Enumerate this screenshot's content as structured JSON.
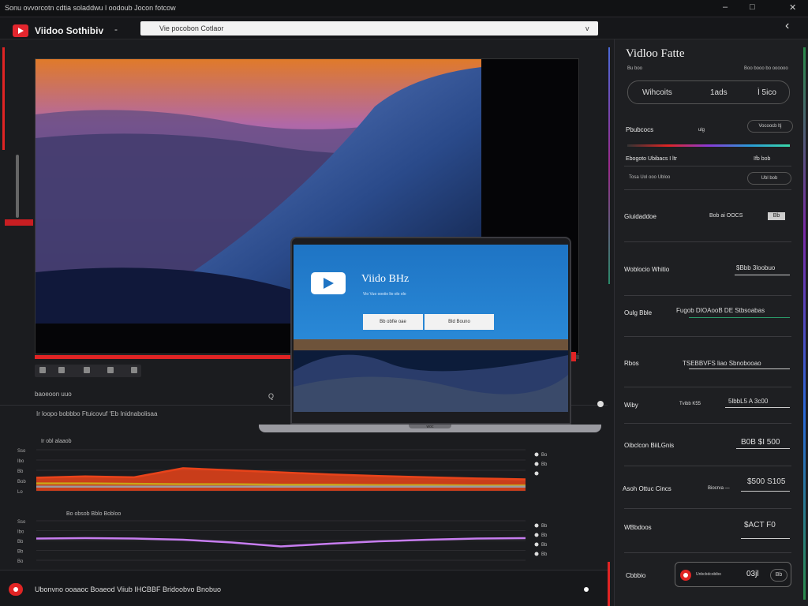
{
  "window": {
    "title": "Sonu  ovvorcotn cdtia  soladdwu l oodoub  Jocon fotcow"
  },
  "toolbar": {
    "app_title": "Viidoo Sothibiv",
    "dash": "-",
    "search_value": "Vie pocobon Cotlaor",
    "search_caret": "v"
  },
  "player": {
    "progress": 0.47
  },
  "meta": {
    "line1": "baoeoon uuo",
    "line2": "Ir loopo bobbbo   Ftuicovuf   ‘Eb   Inidnabolisaa",
    "search_btn": "Q"
  },
  "laptop": {
    "screen_title": "Viido BHz",
    "screen_sub": "Vio Vuo oooiio lio olo olo",
    "btn1": "Bb obfie oae",
    "btn2": "Bld Bouno",
    "notch_label": "woc"
  },
  "chart_data": [
    {
      "type": "area",
      "title": "Ir obl alaaob",
      "ylabel_ticks": [
        "Sso",
        "Ibo",
        "Bb",
        "Bob",
        "Lo"
      ],
      "x": [
        0,
        10,
        20,
        30,
        40,
        50,
        60,
        70,
        80,
        90,
        100
      ],
      "series": [
        {
          "values": [
            0.32,
            0.35,
            0.33,
            0.55,
            0.5,
            0.45,
            0.4,
            0.36,
            0.33,
            0.3,
            0.28
          ],
          "color": "#e8431a"
        },
        {
          "values": [
            0.18,
            0.18,
            0.17,
            0.16,
            0.16,
            0.15,
            0.15,
            0.14,
            0.14,
            0.13,
            0.13
          ],
          "color": "#c9a41a"
        },
        {
          "values": [
            0.1,
            0.1,
            0.1,
            0.1,
            0.1,
            0.1,
            0.1,
            0.1,
            0.1,
            0.1,
            0.1
          ],
          "color": "#9a9aa0"
        }
      ],
      "legend": [
        "Bo",
        "Bb",
        ""
      ]
    },
    {
      "type": "line",
      "title": "Bo obsob  Bblo  Bobloo",
      "ylabel_ticks": [
        "Sso",
        "Ibo",
        "Bb",
        "Bb",
        "Bo"
      ],
      "x": [
        0,
        10,
        20,
        30,
        40,
        50,
        60,
        70,
        80,
        90,
        100
      ],
      "series": [
        {
          "values": [
            0.55,
            0.56,
            0.55,
            0.52,
            0.45,
            0.35,
            0.42,
            0.48,
            0.52,
            0.55,
            0.56
          ],
          "color": "#c77df0"
        }
      ],
      "legend": [
        "Bb",
        "Bb",
        "Bb",
        "Bb"
      ]
    }
  ],
  "footer": {
    "text": "Ubonvno ooaaoc  Boaeod Viiub  IHCBBF  Bridoobvo Bnobuo"
  },
  "panel": {
    "title": "Vidloo Fatte",
    "sub_left": "Bu boo",
    "sub_right": "Boo booo bo oooooo",
    "box": {
      "left": "Wihcoits",
      "mid": "1ads",
      "right": "Ì 5ico"
    },
    "rows": [
      {
        "label": "Pbubcocs",
        "mid": "ulg",
        "pill": "Vocoocb  ltj"
      },
      {
        "label": "Ebogoto Ubibacs I    ltr",
        "val": "Ifb bob"
      },
      {
        "label": "Tosa Uol ooo Ubloo",
        "pill": "Ubl bob"
      },
      {
        "label": "Giuidaddoe",
        "mid": "Bob  ai OOCS",
        "chip": "Bb"
      },
      {
        "label": "Woblocio Whitio",
        "val": "$Bbb 3loobuo"
      },
      {
        "label": "Oulg Bble",
        "val": "Fugob DIOAooB DE Stbsoabas"
      },
      {
        "label": "Rbos",
        "val": "TSEBBVFS liao Sbnobooao"
      },
      {
        "label": "Wiby",
        "mid": "Tvibb K55",
        "val": "5lbbL5 A 3c00"
      },
      {
        "label": "Oibclcon BiiLGnis",
        "val": "B0B  $I 500"
      },
      {
        "label": "Asoh  Ottuc Cincs",
        "mid": "Biocrva  —",
        "val": "$500  S105"
      },
      {
        "label": "WBbdoos",
        "val": "$ACT F0"
      }
    ],
    "foot": {
      "label": "Cbbbio",
      "inner_label": "Unbcbdcobibo",
      "value": "03jl",
      "pill": "Bb"
    }
  }
}
